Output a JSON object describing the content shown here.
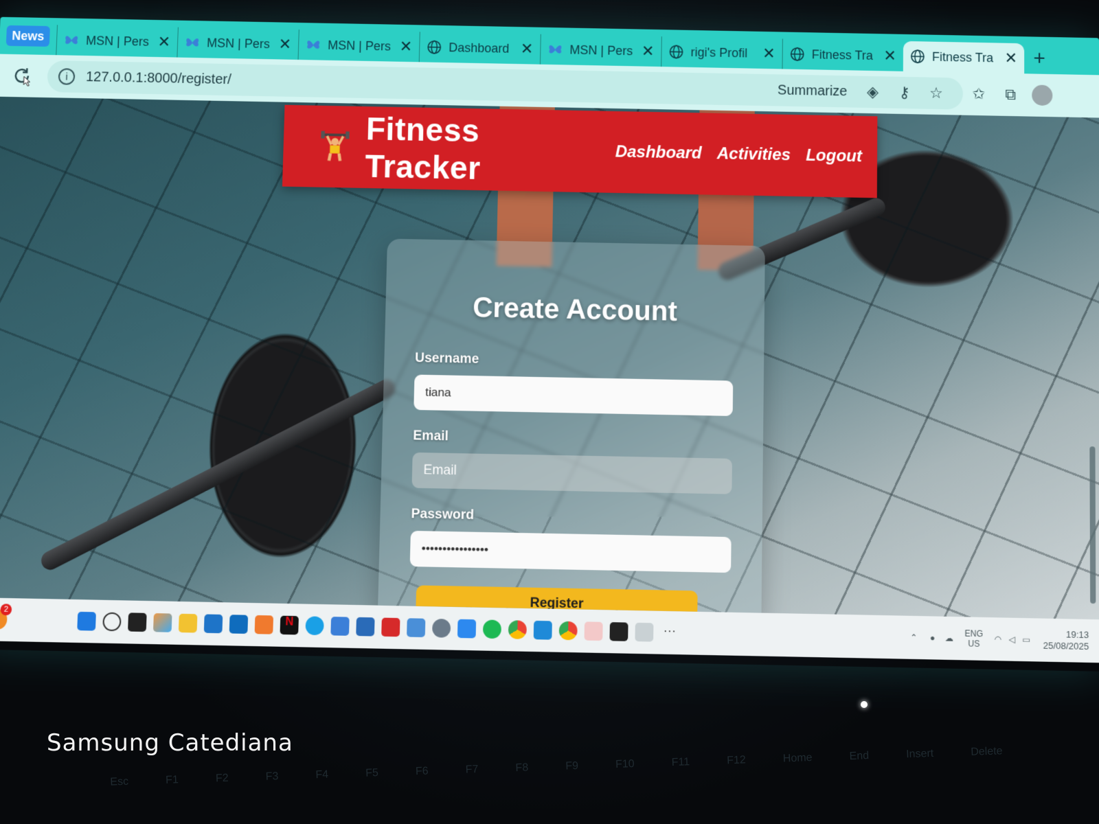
{
  "browser": {
    "news_badge": "News",
    "tabs": [
      {
        "label": "MSN | Pers",
        "icon": "msn-butterfly-icon"
      },
      {
        "label": "MSN | Pers",
        "icon": "msn-butterfly-icon"
      },
      {
        "label": "MSN | Pers",
        "icon": "msn-butterfly-icon"
      },
      {
        "label": "Dashboard",
        "icon": "globe-icon"
      },
      {
        "label": "MSN | Pers",
        "icon": "msn-butterfly-icon"
      },
      {
        "label": "rigi's Profil",
        "icon": "globe-icon"
      },
      {
        "label": "Fitness Tra",
        "icon": "globe-icon"
      },
      {
        "label": "Fitness Tra",
        "icon": "globe-icon"
      }
    ],
    "active_tab_index": 7,
    "url": "127.0.0.1:8000/register/",
    "summarize_label": "Summarize"
  },
  "site": {
    "brand": "Fitness Tracker",
    "brand_icon": "weightlifter-icon",
    "brand_color": "#d21f24",
    "nav": {
      "dashboard": "Dashboard",
      "activities": "Activities",
      "logout": "Logout"
    }
  },
  "form": {
    "title": "Create Account",
    "username_label": "Username",
    "username_value": "tiana",
    "email_label": "Email",
    "email_placeholder": "Email",
    "password_label": "Password",
    "password_value": "passwordpassword",
    "submit_label": "Register",
    "submit_color": "#f3b81e"
  },
  "taskbar": {
    "notification_count": "2",
    "lang_top": "ENG",
    "lang_bottom": "US",
    "time": "19:13",
    "date": "25/08/2025"
  },
  "photo": {
    "watermark": "Samsung Catediana",
    "keyboard_keys": [
      "Esc",
      "F1",
      "F2",
      "F3",
      "F4",
      "F5",
      "F6",
      "F7",
      "F8",
      "F9",
      "F10",
      "F11",
      "F12",
      "Home",
      "End",
      "Insert",
      "Delete"
    ]
  }
}
